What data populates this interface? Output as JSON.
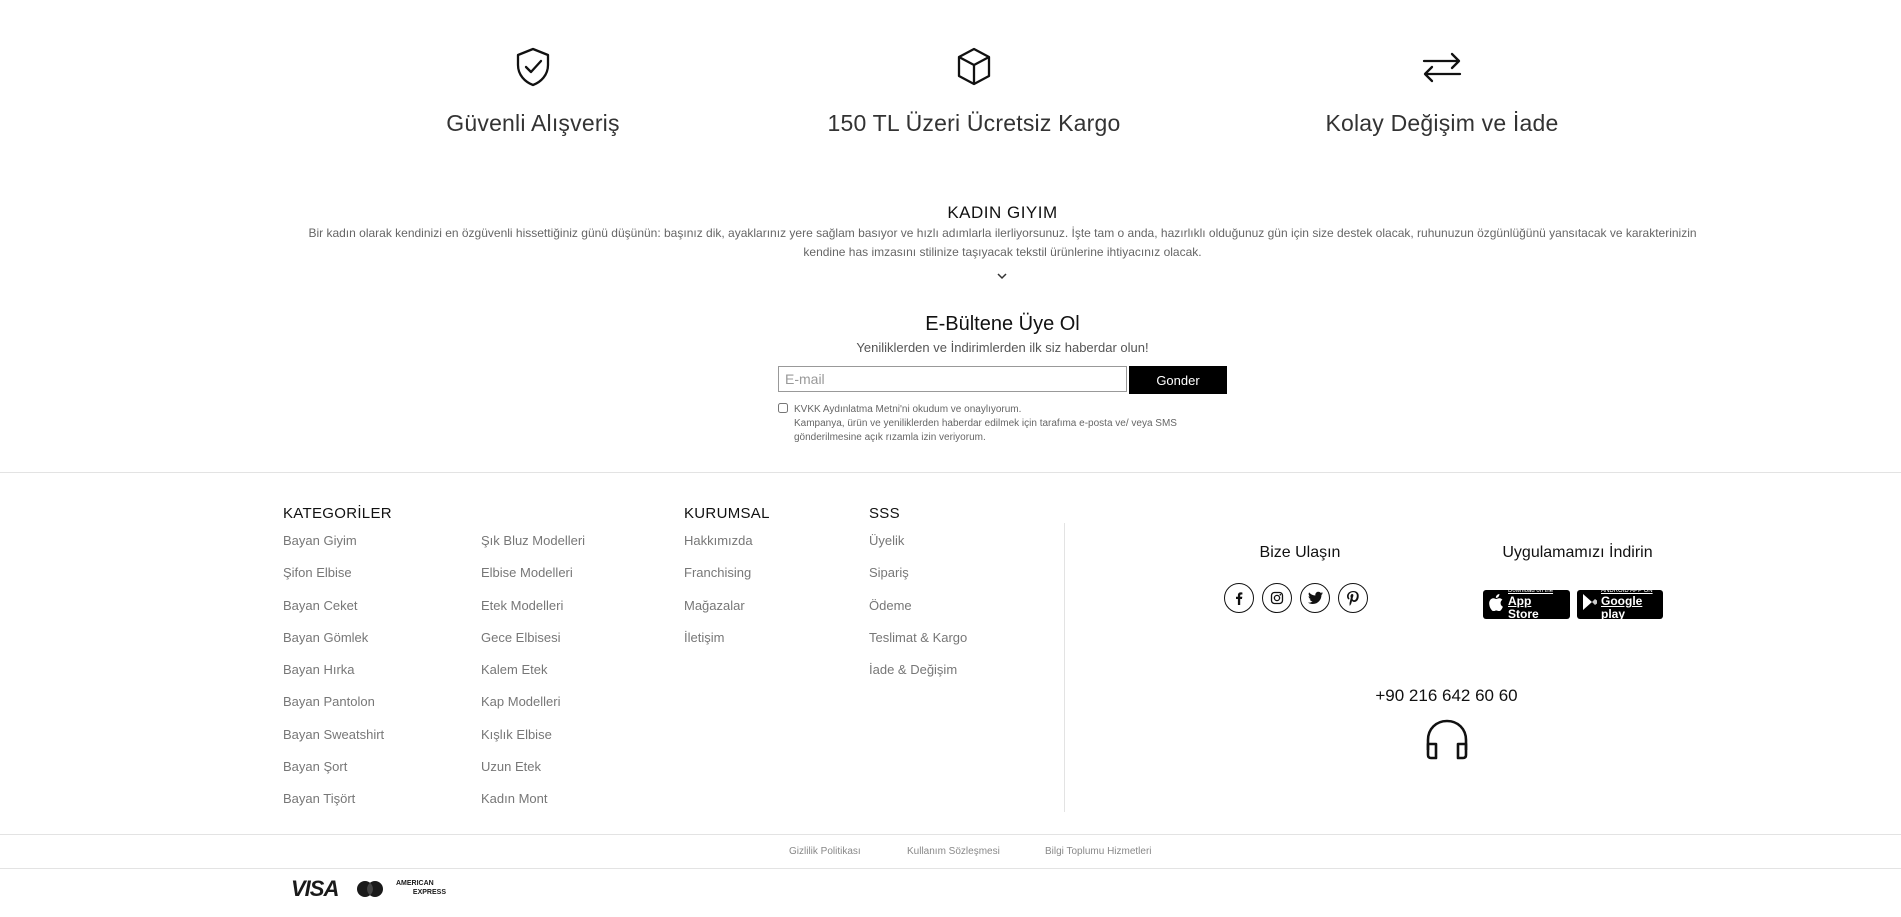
{
  "features": [
    {
      "icon": "shield-check-icon",
      "title": "Güvenli Alışveriş"
    },
    {
      "icon": "box-icon",
      "title": "150 TL Üzeri Ücretsiz Kargo"
    },
    {
      "icon": "exchange-arrows-icon",
      "title": "Kolay Değişim ve İade"
    }
  ],
  "kadin_giyim": {
    "title": "KADIN GIYIM",
    "text": "Bir kadın olarak kendinizi en özgüvenli hissettiğiniz günü düşünün: başınız dik, ayaklarınız yere sağlam basıyor ve hızlı adımlarla ilerliyorsunuz. İşte tam o anda, hazırlıklı olduğunuz gün için size destek olacak, ruhunuzun özgünlüğünü yansıtacak ve karakterinizin kendine has imzasını stilinize taşıyacak tekstil ürünlerine ihtiyacınız olacak."
  },
  "newsletter": {
    "title": "E-Bültene Üye Ol",
    "subtitle": "Yeniliklerden ve İndirimlerden ilk siz haberdar olun!",
    "email_placeholder": "E-mail",
    "submit_label": "Gonder",
    "consent_line1": "KVKK Aydınlatma Metni'ni okudum ve onaylıyorum.",
    "consent_line2": "Kampanya, ürün ve yeniliklerden haberdar edilmek için tarafıma e-posta ve/ veya SMS gönderilmesine açık rızamla izin veriyorum."
  },
  "footer": {
    "categories": {
      "heading": "KATEGORİLER",
      "col1": [
        "Bayan Giyim",
        "Şifon Elbise",
        "Bayan Ceket",
        "Bayan Gömlek",
        "Bayan Hırka",
        "Bayan Pantolon",
        "Bayan Sweatshirt",
        "Bayan Şort",
        "Bayan Tişört"
      ],
      "col2": [
        "Şık Bluz Modelleri",
        "Elbise Modelleri",
        "Etek Modelleri",
        "Gece Elbisesi",
        "Kalem Etek",
        "Kap Modelleri",
        "Kışlık Elbise",
        "Uzun Etek",
        "Kadın Mont"
      ]
    },
    "corporate": {
      "heading": "KURUMSAL",
      "items": [
        "Hakkımızda",
        "Franchising",
        "Mağazalar",
        "İletişim"
      ]
    },
    "faq": {
      "heading": "SSS",
      "items": [
        "Üyelik",
        "Sipariş",
        "Ödeme",
        "Teslimat & Kargo",
        "İade & Değişim"
      ]
    },
    "contact": {
      "title": "Bize Ulaşın",
      "social": [
        "facebook-icon",
        "instagram-icon",
        "twitter-icon",
        "pinterest-icon"
      ],
      "phone": "+90 216 642 60 60"
    },
    "apps": {
      "title": "Uygulamamızı İndirin",
      "app_store_small": "Download on the",
      "app_store_big": "App Store",
      "google_play_small": "ANDROID APP ON",
      "google_play_big": "Google play"
    },
    "bottom_links": [
      "Gizlilik Politikası",
      "Kullanım Sözleşmesi",
      "Bilgi Toplumu Hizmetleri"
    ],
    "payment": {
      "visa": "VISA",
      "amex_line1": "AMERICAN",
      "amex_line2": "EXPRESS",
      "mastercard": "MasterCard"
    }
  }
}
